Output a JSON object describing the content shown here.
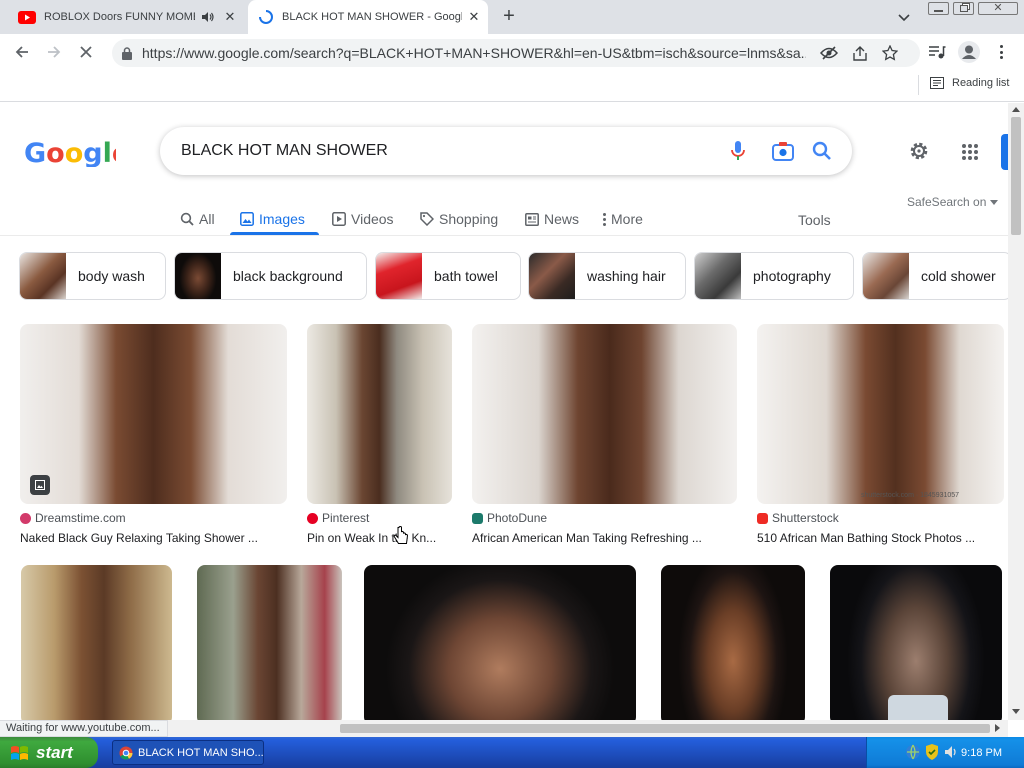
{
  "browser": {
    "tabs": [
      {
        "title": "ROBLOX Doors FUNNY MOMEN",
        "active": false
      },
      {
        "title": "BLACK HOT MAN SHOWER - Google",
        "active": true
      }
    ],
    "new_tab_label": "+",
    "url": "https://www.google.com/search?q=BLACK+HOT+MAN+SHOWER&hl=en-US&tbm=isch&source=lnms&sa...",
    "reading_list_label": "Reading list",
    "status_text": "Waiting for www.youtube.com..."
  },
  "google": {
    "query": "BLACK HOT MAN SHOWER",
    "nav_tabs": [
      "All",
      "Images",
      "Videos",
      "Shopping",
      "News",
      "More"
    ],
    "active_tab": "Images",
    "tools_label": "Tools",
    "safesearch_label": "SafeSearch on",
    "chips": [
      "body wash",
      "black background",
      "bath towel",
      "washing hair",
      "photography",
      "cold shower"
    ],
    "results_row1": [
      {
        "source": "Dreamstime.com",
        "caption": "Naked Black Guy Relaxing Taking Shower ..."
      },
      {
        "source": "Pinterest",
        "caption": "Pin on Weak In the Kn..."
      },
      {
        "source": "PhotoDune",
        "caption": "African American Man Taking Refreshing ..."
      },
      {
        "source": "Shutterstock",
        "caption": "510 African Man Bathing Stock Photos ..."
      }
    ],
    "watermark": "shutterstock.com · 1845931057"
  },
  "taskbar": {
    "start_label": "start",
    "window_label": "BLACK HOT MAN SHO...",
    "clock": "9:18 PM"
  },
  "colors": {
    "google_blue": "#1a73e8",
    "source_pinterest": "#e60023",
    "source_shutterstock": "#ee2b24",
    "source_photodune": "#1c7a6b",
    "source_dreamstime": "#d23a6a"
  }
}
